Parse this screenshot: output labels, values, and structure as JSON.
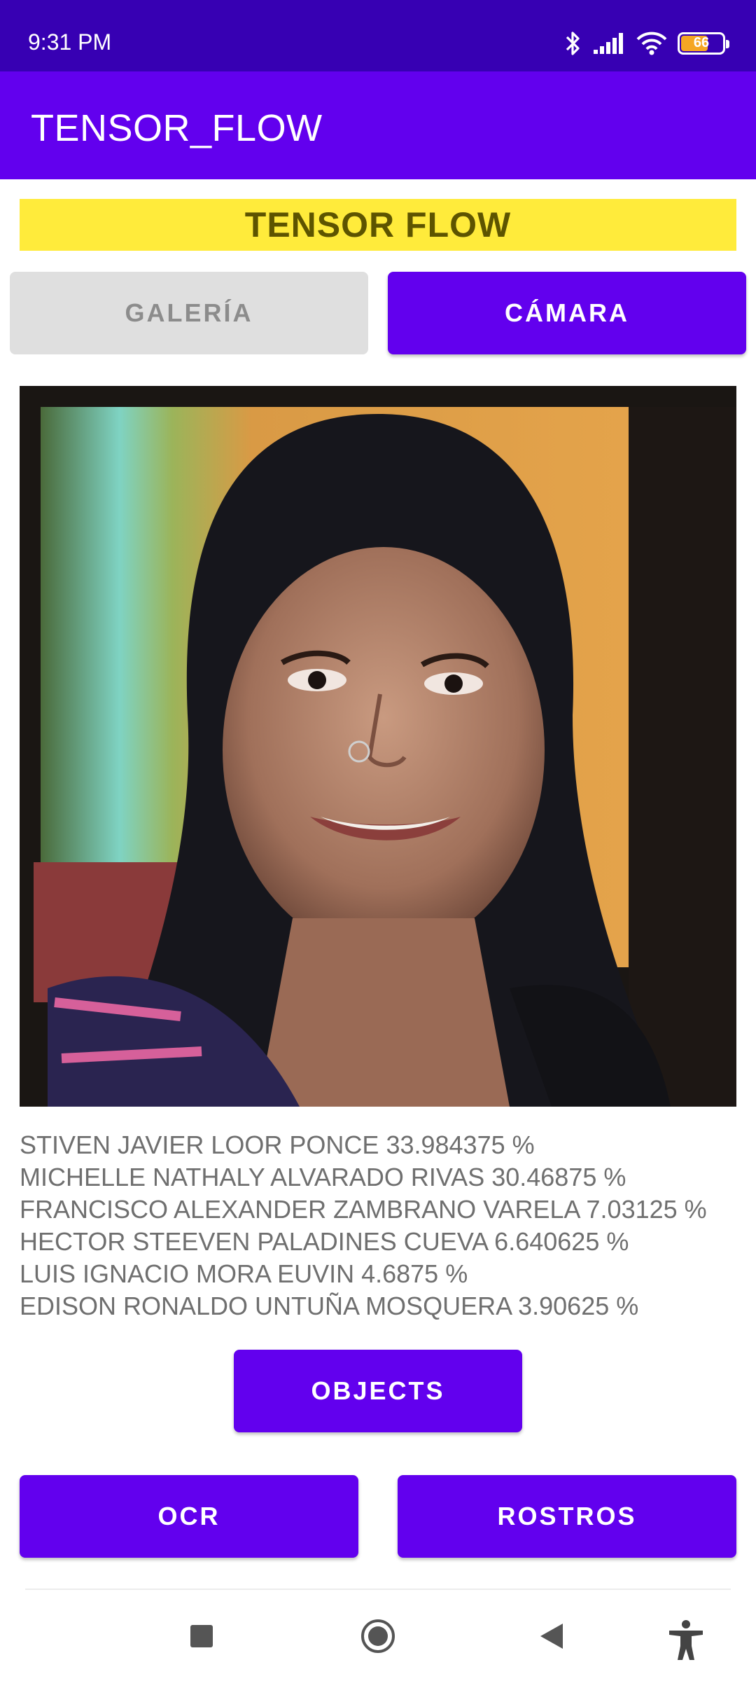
{
  "status_bar": {
    "time": "9:31 PM",
    "battery_level": "66",
    "icons": [
      "bluetooth-icon",
      "cellular-signal-icon",
      "wifi-icon",
      "battery-icon"
    ]
  },
  "app_bar": {
    "title": "TENSOR_FLOW"
  },
  "banner": {
    "text": "TENSOR FLOW",
    "background": "#ffeb3b"
  },
  "source_buttons": {
    "gallery_label": "GALERÍA",
    "camera_label": "CÁMARA"
  },
  "preview_image": {
    "description_icon": "face-photo"
  },
  "results": [
    "STIVEN JAVIER LOOR PONCE 33.984375 %",
    "MICHELLE NATHALY ALVARADO RIVAS 30.46875 %",
    "FRANCISCO ALEXANDER ZAMBRANO VARELA 7.03125 %",
    "HECTOR STEEVEN PALADINES CUEVA 6.640625 %",
    "LUIS IGNACIO MORA EUVIN 4.6875 %",
    "EDISON RONALDO UNTUÑA MOSQUERA 3.90625 %"
  ],
  "action_buttons": {
    "objects_label": "OBJECTS",
    "ocr_label": "OCR",
    "faces_label": "ROSTROS"
  },
  "nav_bar": {
    "icons": [
      "recents-square-icon",
      "home-circle-icon",
      "back-triangle-icon",
      "accessibility-icon"
    ]
  },
  "colors": {
    "status_bar": "#3700b3",
    "primary": "#6200ee",
    "disabled_button": "#dfdfdf",
    "result_text": "#6f6f6f"
  }
}
